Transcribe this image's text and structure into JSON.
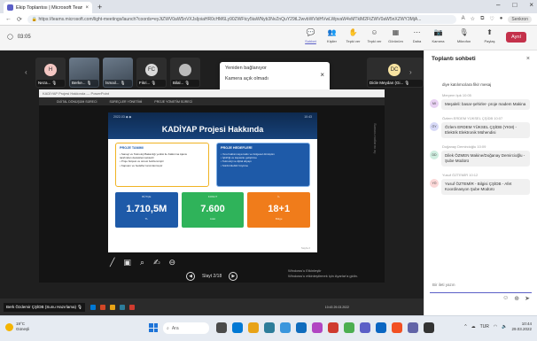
{
  "browser": {
    "tab_title": "Ekip Toplantısı | Microsoft Teams",
    "url": "https://teams.microsoft.com/light-meetings/launch?coords=eyJtZWV0aW5nVXJsIjoiaHR0cHM6Ly90ZWFtcy5taWNyb3NvZnQuY29tL2wvbWVldHVwLWpvaW4vMTklM2FtZWV0aW5nXZWY3MjA...",
    "new_tab": "+",
    "profile_label": "Senkron"
  },
  "teams_header": {
    "back_icon": "back-icon",
    "meeting_title": "03:05",
    "tools": [
      {
        "label": "Sohbet",
        "icon": "💬",
        "active": true
      },
      {
        "label": "Kişiler",
        "icon": "👥",
        "active": false
      },
      {
        "label": "Tepki ver",
        "icon": "✋",
        "active": false
      },
      {
        "label": "Tepki ver",
        "icon": "☺",
        "active": false
      },
      {
        "label": "Görünüm",
        "icon": "▦",
        "active": false
      },
      {
        "label": "Daha",
        "icon": "⋯",
        "active": false
      }
    ],
    "device_tools": [
      {
        "label": "Kamera",
        "icon": "📷"
      },
      {
        "label": "Mikrofon",
        "icon": "🎙"
      },
      {
        "label": "Paylaş",
        "icon": "⬆"
      }
    ],
    "leave_label": "Ayrıl"
  },
  "gallery": {
    "tiles": [
      {
        "initials": "H",
        "name": "Neza... 🎙",
        "color": "#f4c7c3",
        "photo": false
      },
      {
        "initials": "",
        "name": "Berke... 🎙",
        "color": "#9aa8b5",
        "photo": true
      },
      {
        "initials": "",
        "name": "İsmail... 🎙",
        "color": "#9aa8b5",
        "photo": true
      },
      {
        "initials": "FC",
        "name": "Fikri... 🎙",
        "color": "#d9d9d9",
        "photo": false
      },
      {
        "initials": "",
        "name": "Bilal... 🎙",
        "color": "#bbbbbb",
        "photo": false
      }
    ],
    "extra_tile": {
      "initials": "DC",
      "name": "Dicle Meydan (Gi... 🎙",
      "color": "#f7e3a1"
    }
  },
  "toast": {
    "line1": "Yeniden bağlanıyor",
    "line2": "Kamera açık olmadı",
    "close": "×"
  },
  "share": {
    "window_title": "KADİYAP Projesi Hakkında — PowerPoint",
    "menu": [
      "DİJİTAL DÖNÜŞÜM SÜRECİ",
      "SÜREÇLER YÖNETİMİ",
      "PROJE YÖNETİM SÜRECİ"
    ],
    "side_label": "Sunucu notlarını aç",
    "slide": {
      "meta_left": "2022-03  ◆  ◆",
      "meta_right": "10:43",
      "title": "KADİYAP Projesi Hakkında",
      "left_box": {
        "heading": "PROJE TANIMI",
        "lines": [
          "• Sanayi ve Teknoloji Bakanlığı yetkisi ile Kalkınma Ajansı",
          "  tarafından desteklenmektedir",
          "• Proje bütçesi ve süresi belirlenmiştir",
          "• Kapsam ve hedefler tanımlanmıştır"
        ]
      },
      "right_box": {
        "heading": "PROJE HEDEFLERİ",
        "lines": [
          "• Yerel kalkınmaya katkı ve bölgesel dönüşüm",
          "• İşbirliği ve kapasite geliştirme",
          "• Teknoloji ve dijital altyapı",
          "• Sürdürülebilir büyüme"
        ]
      },
      "stats": [
        {
          "label": "BÜTÇE",
          "value": "1.710,5M",
          "unit": "TL",
          "color": "#1e5aa8"
        },
        {
          "label": "KONUT",
          "value": "7.600",
          "unit": "Adet",
          "color": "#2fb35a"
        },
        {
          "label": "İL",
          "value": "18+1",
          "unit": "Bölge",
          "color": "#f07c1b"
        }
      ],
      "footer": "Sayfa 2"
    },
    "annot_tools": [
      "╱",
      "▣",
      "⌕",
      "✍",
      "⊖"
    ],
    "slide_nav": {
      "prev": "◀",
      "label": "Slayt 2/18",
      "next": "▶"
    },
    "watermark": [
      "Windows'u Etkinleştir",
      "Windows'u etkinleştirmek için Ayarlar'a gidin."
    ],
    "presenter_label": "Berk Özdemir ÇŞİDB (Sunu Hazırlama) 🎙",
    "mini_clock": "10:43  29.03.2022"
  },
  "chat": {
    "title": "Toplantı sohbeti",
    "close": "×",
    "cut_message": "diye katılımcılara fikir mesaj",
    "messages": [
      {
        "meta": "Meryem Işık  10:05",
        "initials": "MI",
        "color": "#e8d1f2",
        "text": "Meşaleli: basar-şehirler- proje madem Makina"
      },
      {
        "meta": "Özlem ERDEM YÜKSEL ÇŞİDB  10:07",
        "initials": "ÖY",
        "color": "#d7d9f7",
        "text": "Özlem ERDEM YÜKSEL ÇŞİDB (YKM) - Elektrik Elektronik Mühendisi"
      },
      {
        "meta": "Doğanay Demircioğlu  10:09",
        "initials": "DD",
        "color": "#cfeee0",
        "text": "Dilek ÖZMEN Makine/Doğanay Demircioğlu - Şube Müdürü"
      },
      {
        "meta": "Yusuf ÖZTEMİR  10:12",
        "initials": "YÖ",
        "color": "#fbd7d7",
        "text": "Yusuf ÖZTEMİR - Bilgisi ÇŞİDB - Afet Koordinasyon Şube Müdürü"
      }
    ],
    "input_placeholder": "Bir ileti yazın",
    "tools": [
      "☺",
      "⊕",
      "➤"
    ]
  },
  "windows": {
    "weather_temp": "19°C",
    "weather_desc": "Güneşli",
    "search_placeholder": "Ara",
    "apps": [
      "#4a4a4a",
      "#0078d4",
      "#e8a317",
      "#2d7d9a",
      "#3a96dd",
      "#0f6cbd",
      "#b146c2",
      "#cf3b2f",
      "#4caf50",
      "#5b5fc7",
      "#0a66c2",
      "#f25022",
      "#6264a7",
      "#333333"
    ],
    "tray": {
      "lang": "TUR",
      "time": "10:44",
      "date": "29.03.2022"
    }
  }
}
